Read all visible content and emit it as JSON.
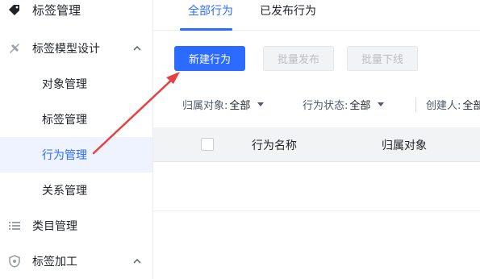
{
  "sidebar": {
    "items": [
      {
        "label": "标签管理",
        "icon": "tag-icon"
      },
      {
        "label": "标签模型设计",
        "icon": "model-icon",
        "expanded": true,
        "children": [
          {
            "label": "对象管理"
          },
          {
            "label": "标签管理"
          },
          {
            "label": "行为管理",
            "active": true
          },
          {
            "label": "关系管理"
          }
        ]
      },
      {
        "label": "类目管理",
        "icon": "list-icon"
      },
      {
        "label": "标签加工",
        "icon": "shield-icon",
        "expanded": true
      }
    ]
  },
  "tabs": [
    {
      "label": "全部行为",
      "active": true
    },
    {
      "label": "已发布行为",
      "active": false
    }
  ],
  "toolbar": {
    "new_label": "新建行为",
    "batch_publish_label": "批量发布",
    "batch_offline_label": "批量下线"
  },
  "filters": [
    {
      "label": "归属对象:",
      "value": "全部"
    },
    {
      "label": "行为状态:",
      "value": "全部"
    },
    {
      "label": "创建人:",
      "value": "全部"
    }
  ],
  "table": {
    "columns": [
      "行为名称",
      "归属对象"
    ]
  },
  "colors": {
    "accent": "#2b6bff",
    "annotation_arrow": "#e8403e",
    "active_bg": "#eef3ff"
  }
}
